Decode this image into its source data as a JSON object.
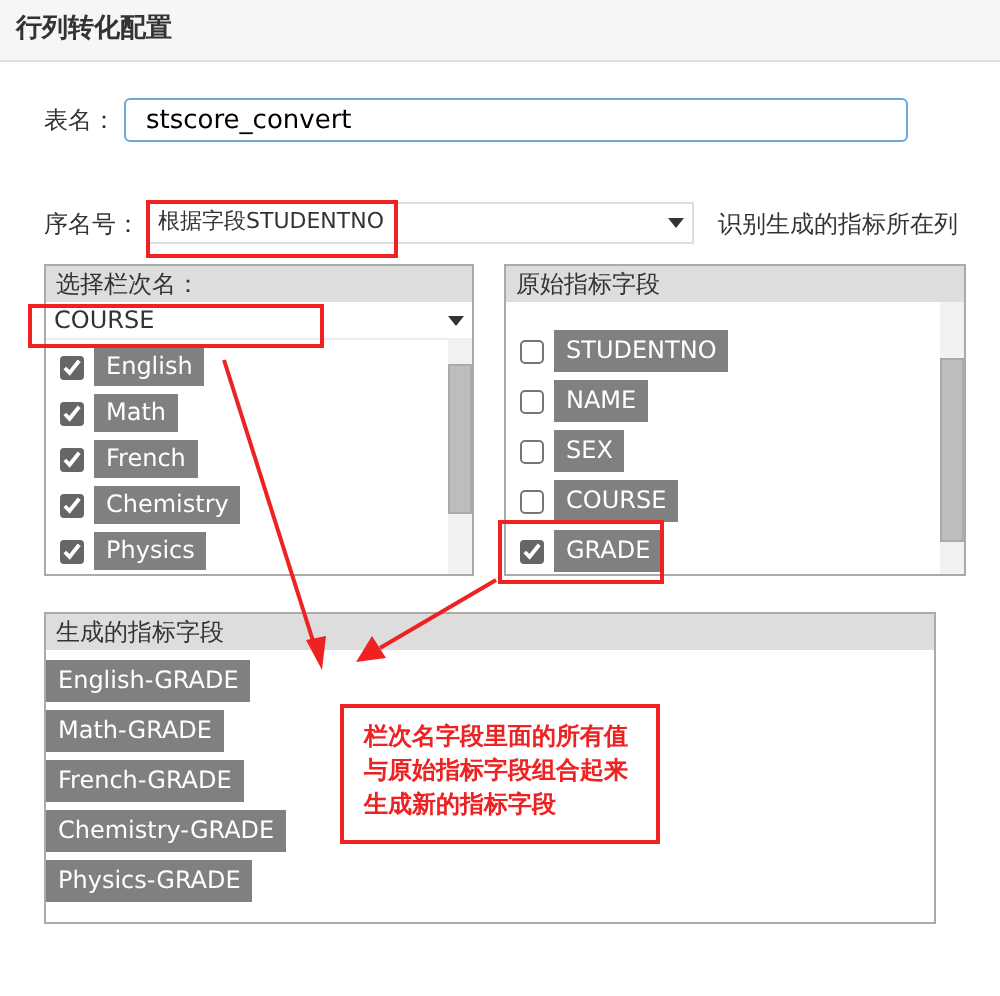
{
  "title": "行列转化配置",
  "table_name": {
    "label": "表名：",
    "value": "stscore_convert"
  },
  "sequence": {
    "label": "序名号：",
    "value": "根据字段STUDENTNO",
    "hint": "识别生成的指标所在列"
  },
  "column_panel": {
    "title": "选择栏次名：",
    "select_value": "COURSE",
    "items": [
      {
        "label": "English",
        "checked": true
      },
      {
        "label": "Math",
        "checked": true
      },
      {
        "label": "French",
        "checked": true
      },
      {
        "label": "Chemistry",
        "checked": true
      },
      {
        "label": "Physics",
        "checked": true
      }
    ]
  },
  "source_panel": {
    "title": "原始指标字段",
    "items": [
      {
        "label": "STUDENTNO",
        "checked": false
      },
      {
        "label": "NAME",
        "checked": false
      },
      {
        "label": "SEX",
        "checked": false
      },
      {
        "label": "COURSE",
        "checked": false
      },
      {
        "label": "GRADE",
        "checked": true
      }
    ]
  },
  "generated_panel": {
    "title": "生成的指标字段",
    "items": [
      "English-GRADE",
      "Math-GRADE",
      "French-GRADE",
      "Chemistry-GRADE",
      "Physics-GRADE"
    ]
  },
  "note": "栏次名字段里面的所有值与原始指标字段组合起来生成新的指标字段"
}
